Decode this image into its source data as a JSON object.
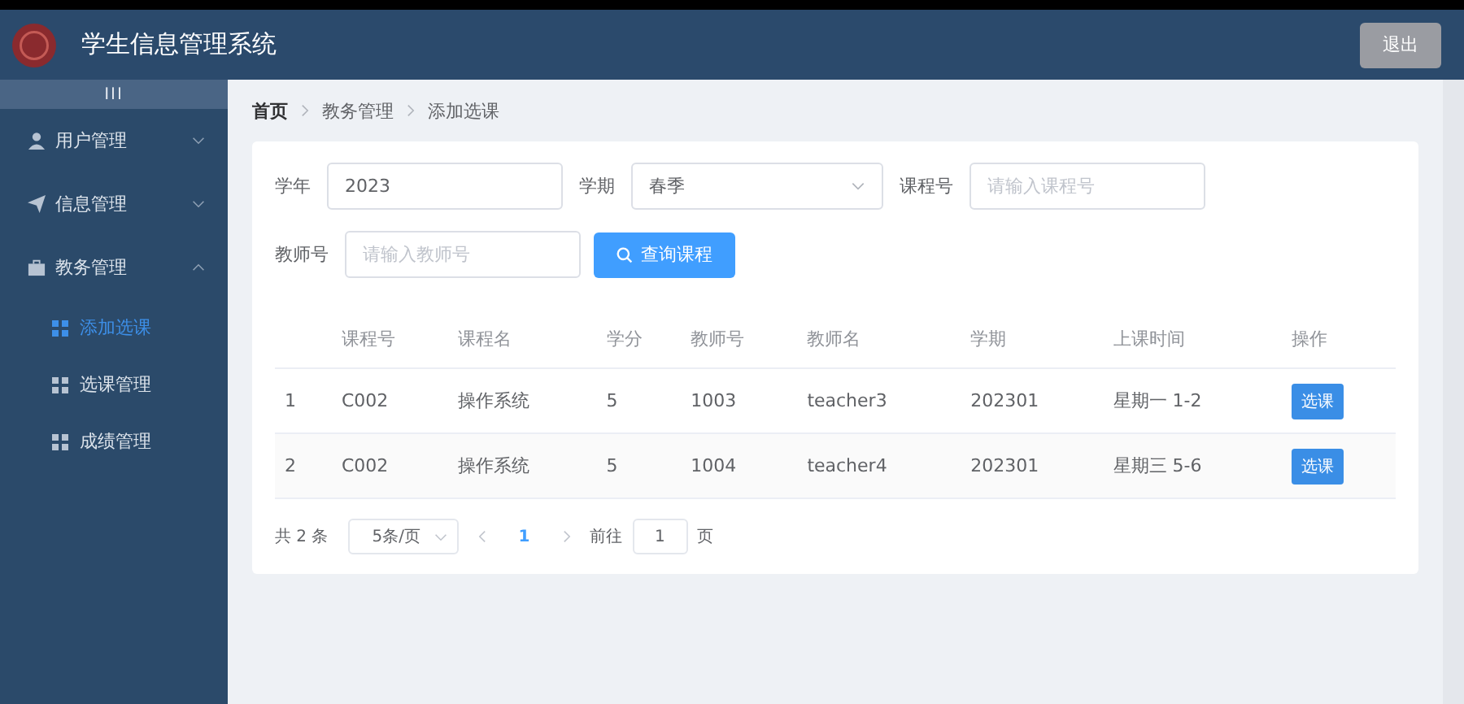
{
  "header": {
    "title": "学生信息管理系统",
    "logout": "退出"
  },
  "sidebar": {
    "toggle": "III",
    "items": [
      {
        "label": "用户管理",
        "expanded": false
      },
      {
        "label": "信息管理",
        "expanded": false
      },
      {
        "label": "教务管理",
        "expanded": true,
        "children": [
          {
            "label": "添加选课",
            "selected": true
          },
          {
            "label": "选课管理",
            "selected": false
          },
          {
            "label": "成绩管理",
            "selected": false
          }
        ]
      }
    ]
  },
  "breadcrumb": [
    "首页",
    "教务管理",
    "添加选课"
  ],
  "filters": {
    "year_label": "学年",
    "year": "2023",
    "term_label": "学期",
    "term": "春季",
    "course_label": "课程号",
    "course_placeholder": "请输入课程号",
    "teacher_label": "教师号",
    "teacher_placeholder": "请输入教师号",
    "search": "查询课程"
  },
  "table": {
    "columns": [
      "",
      "课程号",
      "课程名",
      "学分",
      "教师号",
      "教师名",
      "学期",
      "上课时间",
      "操作"
    ],
    "rows": [
      {
        "cells": [
          "1",
          "C002",
          "操作系统",
          "5",
          "1003",
          "teacher3",
          "202301",
          "星期一 1-2"
        ],
        "action": "选课"
      },
      {
        "cells": [
          "2",
          "C002",
          "操作系统",
          "5",
          "1004",
          "teacher4",
          "202301",
          "星期三 5-6"
        ],
        "action": "选课"
      }
    ]
  },
  "pagination": {
    "total": "共 2 条",
    "page_size": "5条/页",
    "pages": [
      {
        "label": "1",
        "selected": true
      }
    ],
    "goto_label": "前往",
    "goto": "1",
    "page_unit": "页"
  }
}
